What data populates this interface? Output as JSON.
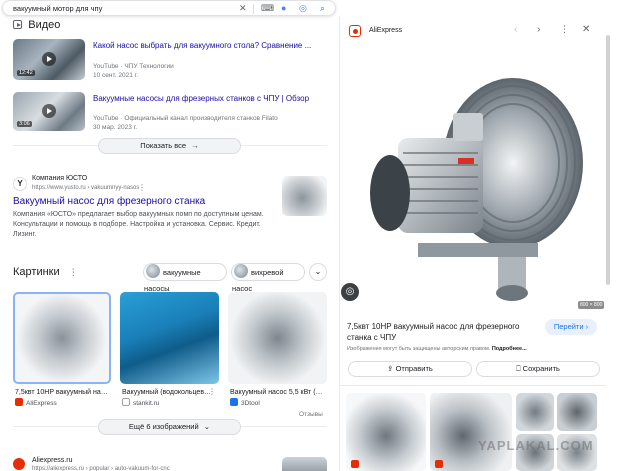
{
  "search": {
    "query": "вакуумный мотор для чпу"
  },
  "videos": {
    "heading": "Видео",
    "items": [
      {
        "title_line1": "Какой насос выбрать для вакуумного стола? Сравнение ...",
        "source": "YouTube · ЧПУ Технологии",
        "date": "10 сент. 2021 г.",
        "duration": "12:42"
      },
      {
        "title_line1": "Вакуумные насосы для фрезерных станков с ЧПУ | Обзор",
        "source": "YouTube · Официальный канал производителя станков Filato",
        "date": "30 мар. 2023 г.",
        "duration": "3:06"
      }
    ],
    "show_all": "Показать все"
  },
  "ad_result": {
    "company": "Компания ЮСТО",
    "url": "https://www.yusto.ru › vakuumnyy-nasos",
    "favicon_letter": "Y",
    "title": "Вакуумный насос для фрезерного станка",
    "snippet_line1": "Компания «ЮСТО» предлагает выбор вакуумных помп по доступным ценам.",
    "snippet_line2": "Консультации и помощь в подборе. Настройка и установка. Сервис. Кредит.",
    "snippet_line3": "Лизинг."
  },
  "images": {
    "heading": "Картинки",
    "chips": [
      "вакуумные насосы",
      "вихревой насос"
    ],
    "cards": [
      {
        "caption": "7,5квт 10HP вакуумный насо...",
        "source": "AliExpress"
      },
      {
        "caption": "Вакуумный (водокольцевой...",
        "source": "stankit.ru"
      },
      {
        "caption": "Вакуумный насос 5,5 кВт (В...",
        "source": "3Dtool"
      }
    ],
    "feedback": "Отзывы",
    "more": "Ещё 6 изображений"
  },
  "bottom_result": {
    "site": "Aliexpress.ru",
    "url": "https://aliexpress.ru › popular › auto-vakuum-for-cnc"
  },
  "panel": {
    "source": "AliExpress",
    "size": "800 × 800",
    "title_line1": "7,5квт 10HP вакуумный насос для фрезерного",
    "title_line2": "станка с ЧПУ",
    "visit": "Перейти",
    "copyright": "Изображения могут быть защищены авторским правом.",
    "more_link": "Подробнее...",
    "share": "Отправить",
    "save": "Сохранить"
  },
  "watermark": "YAPLAKAL.COM",
  "colors": {
    "link": "#1a0dab",
    "accent": "#1a73e8",
    "aliexpress": "#e62e04"
  }
}
